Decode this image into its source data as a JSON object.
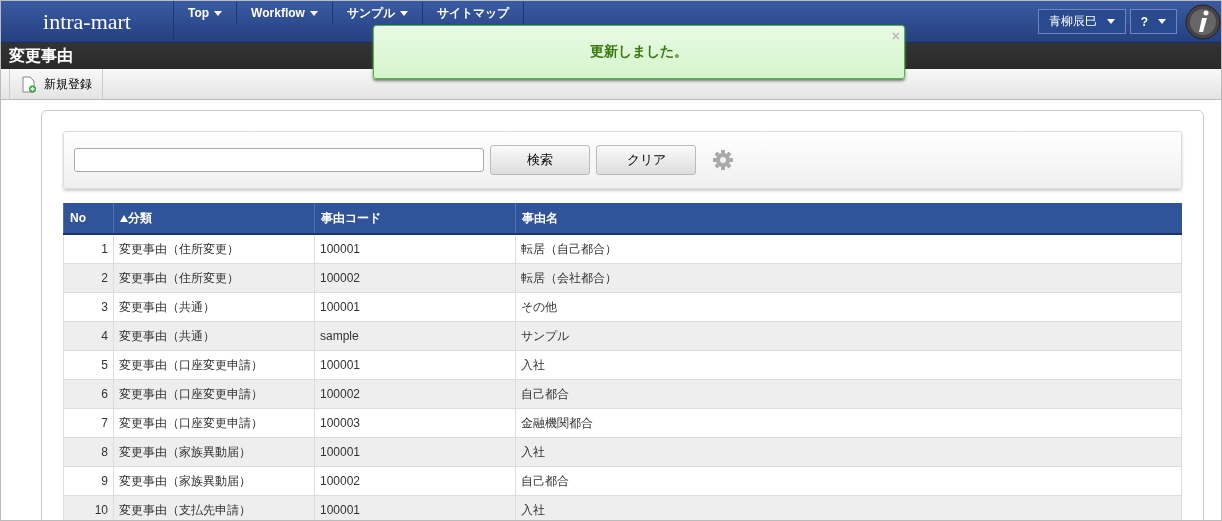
{
  "header": {
    "logo": "intra-mart",
    "nav": [
      {
        "label": "Top",
        "dropdown": true
      },
      {
        "label": "Workflow",
        "dropdown": true
      },
      {
        "label": "サンプル",
        "dropdown": true
      },
      {
        "label": "サイトマップ",
        "dropdown": false
      }
    ],
    "user": "青柳辰巳",
    "help": "?"
  },
  "page_title": "変更事由",
  "toolbar": [
    {
      "label": "新規登録"
    }
  ],
  "toast": {
    "message": "更新しました。",
    "close": "×"
  },
  "search": {
    "buttons": [
      "検索",
      "クリア"
    ]
  },
  "table": {
    "columns": [
      {
        "label": "No",
        "sorted": false
      },
      {
        "label": "分類",
        "sorted": true
      },
      {
        "label": "事由コード",
        "sorted": false
      },
      {
        "label": "事由名",
        "sorted": false
      }
    ],
    "rows": [
      [
        "1",
        "変更事由（住所変更）",
        "100001",
        "転居（自己都合）"
      ],
      [
        "2",
        "変更事由（住所変更）",
        "100002",
        "転居（会社都合）"
      ],
      [
        "3",
        "変更事由（共通）",
        "100001",
        "その他"
      ],
      [
        "4",
        "変更事由（共通）",
        "sample",
        "サンプル"
      ],
      [
        "5",
        "変更事由（口座変更申請）",
        "100001",
        "入社"
      ],
      [
        "6",
        "変更事由（口座変更申請）",
        "100002",
        "自己都合"
      ],
      [
        "7",
        "変更事由（口座変更申請）",
        "100003",
        "金融機関都合"
      ],
      [
        "8",
        "変更事由（家族異動届）",
        "100001",
        "入社"
      ],
      [
        "9",
        "変更事由（家族異動届）",
        "100002",
        "自己都合"
      ],
      [
        "10",
        "変更事由（支払先申請）",
        "100001",
        "入社"
      ]
    ]
  }
}
